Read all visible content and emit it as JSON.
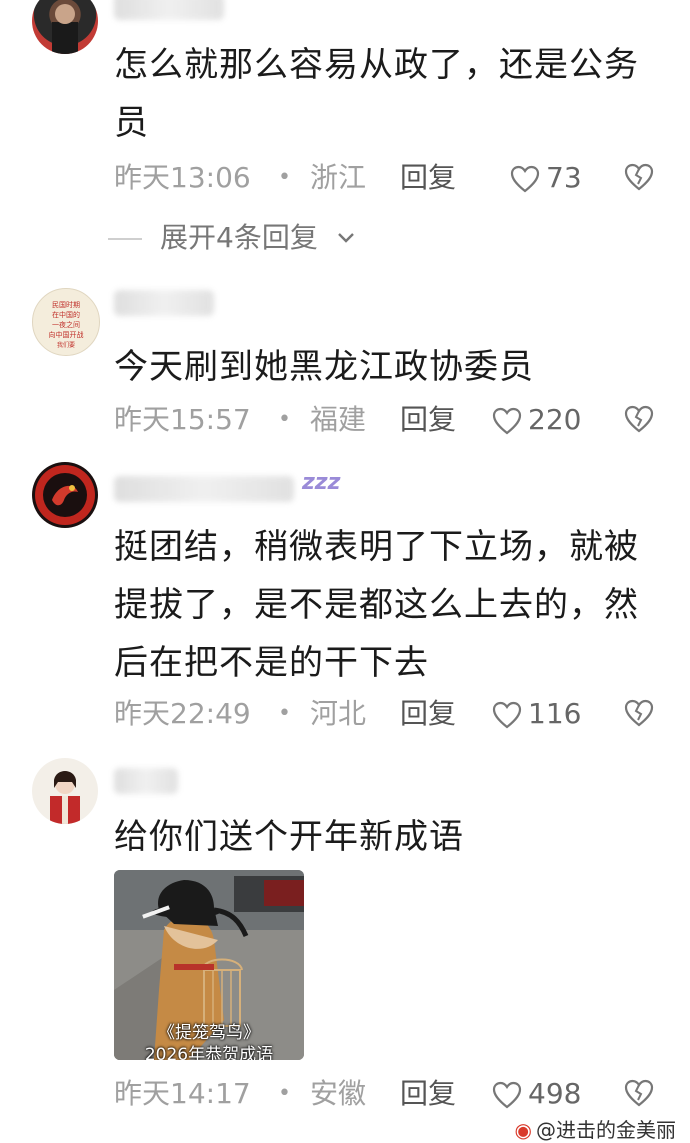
{
  "comments": [
    {
      "text": "怎么就那么容易从政了，还是公务员",
      "time": "昨天13:06",
      "location": "浙江",
      "reply_label": "回复",
      "likes": "73",
      "expand_label": "展开4条回复"
    },
    {
      "text": "今天刷到她黑龙江政协委员",
      "time": "昨天15:57",
      "location": "福建",
      "reply_label": "回复",
      "likes": "220"
    },
    {
      "text": "挺团结，稍微表明了下立场，就被提拔了，是不是都这么上去的，然后在把不是的干下去",
      "time": "昨天22:49",
      "location": "河北",
      "reply_label": "回复",
      "likes": "116"
    },
    {
      "text": "给你们送个开年新成语",
      "time": "昨天14:17",
      "location": "安徽",
      "reply_label": "回复",
      "likes": "498",
      "image_caption_line1": "《提笼驾鸟》",
      "image_caption_line2": "2026年恭贺成语"
    }
  ],
  "separator_dot": "•",
  "zzz_sticker": "zzz",
  "watermark": "@进击的金美丽",
  "colors": {
    "meta_gray": "#a0a0a0",
    "text": "#1b1b1b",
    "background": "#ffffff"
  },
  "icons": [
    "heart-outline-icon",
    "broken-heart-icon",
    "chevron-down-icon",
    "weibo-icon"
  ]
}
